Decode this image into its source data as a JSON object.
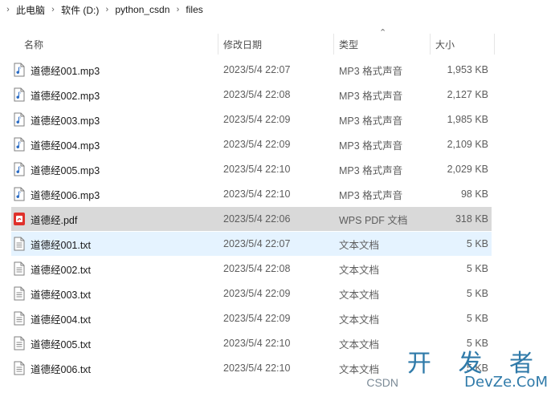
{
  "breadcrumb": [
    "此电脑",
    "软件 (D:)",
    "python_csdn",
    "files"
  ],
  "columns": {
    "name": "名称",
    "date": "修改日期",
    "type": "类型",
    "size": "大小"
  },
  "sort": {
    "column": "类型",
    "direction": "ascending",
    "icon": "sort-caret-up-icon"
  },
  "files": [
    {
      "name": "道德经001.mp3",
      "date": "2023/5/4 22:07",
      "type": "MP3 格式声音",
      "size": "1,953 KB",
      "icon": "audio-file-icon",
      "state": ""
    },
    {
      "name": "道德经002.mp3",
      "date": "2023/5/4 22:08",
      "type": "MP3 格式声音",
      "size": "2,127 KB",
      "icon": "audio-file-icon",
      "state": ""
    },
    {
      "name": "道德经003.mp3",
      "date": "2023/5/4 22:09",
      "type": "MP3 格式声音",
      "size": "1,985 KB",
      "icon": "audio-file-icon",
      "state": ""
    },
    {
      "name": "道德经004.mp3",
      "date": "2023/5/4 22:09",
      "type": "MP3 格式声音",
      "size": "2,109 KB",
      "icon": "audio-file-icon",
      "state": ""
    },
    {
      "name": "道德经005.mp3",
      "date": "2023/5/4 22:10",
      "type": "MP3 格式声音",
      "size": "2,029 KB",
      "icon": "audio-file-icon",
      "state": ""
    },
    {
      "name": "道德经006.mp3",
      "date": "2023/5/4 22:10",
      "type": "MP3 格式声音",
      "size": "98 KB",
      "icon": "audio-file-icon",
      "state": ""
    },
    {
      "name": "道德经.pdf",
      "date": "2023/5/4 22:06",
      "type": "WPS PDF 文档",
      "size": "318 KB",
      "icon": "pdf-file-icon",
      "state": "selected"
    },
    {
      "name": "道德经001.txt",
      "date": "2023/5/4 22:07",
      "type": "文本文档",
      "size": "5 KB",
      "icon": "text-file-icon",
      "state": "hover"
    },
    {
      "name": "道德经002.txt",
      "date": "2023/5/4 22:08",
      "type": "文本文档",
      "size": "5 KB",
      "icon": "text-file-icon",
      "state": ""
    },
    {
      "name": "道德经003.txt",
      "date": "2023/5/4 22:09",
      "type": "文本文档",
      "size": "5 KB",
      "icon": "text-file-icon",
      "state": ""
    },
    {
      "name": "道德经004.txt",
      "date": "2023/5/4 22:09",
      "type": "文本文档",
      "size": "5 KB",
      "icon": "text-file-icon",
      "state": ""
    },
    {
      "name": "道德经005.txt",
      "date": "2023/5/4 22:10",
      "type": "文本文档",
      "size": "5 KB",
      "icon": "text-file-icon",
      "state": ""
    },
    {
      "name": "道德经006.txt",
      "date": "2023/5/4 22:10",
      "type": "文本文档",
      "size": "5 KB",
      "icon": "text-file-icon",
      "state": ""
    }
  ],
  "watermark": {
    "main": "开 发 者",
    "sub": "DevZe.CoM",
    "source": "CSDN"
  },
  "colors": {
    "selected_row": "#d9d9d9",
    "hover_row": "#e5f3ff",
    "audio_icon": "#2b6cc4",
    "pdf_icon": "#e0312b",
    "watermark": "#2f7aa9"
  }
}
